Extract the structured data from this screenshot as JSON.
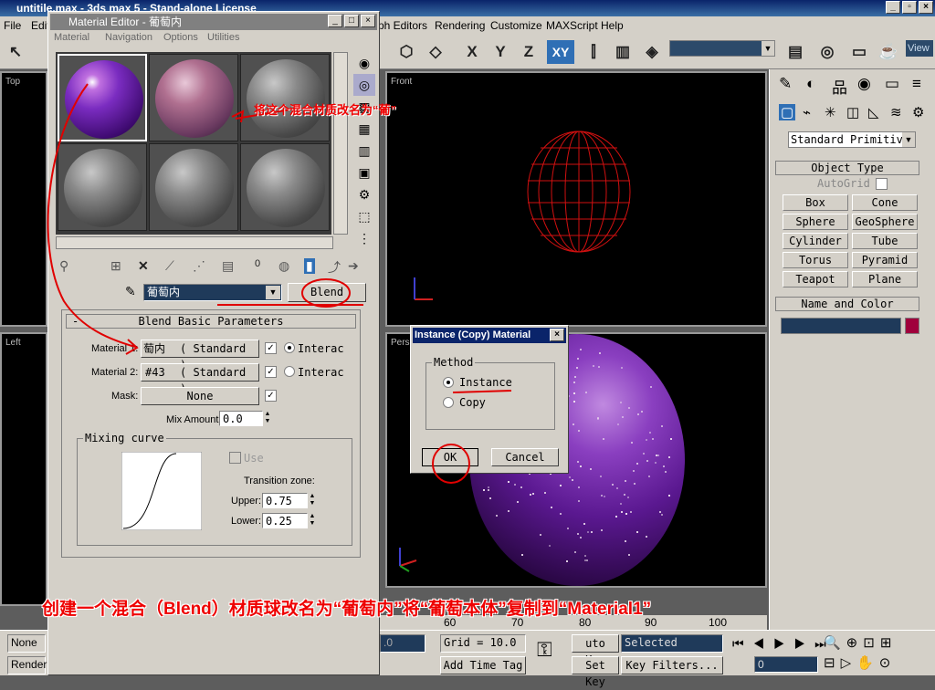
{
  "app": {
    "title": "untitile.max - 3ds max 5 - Stand-alone License"
  },
  "menu": [
    "File",
    "Edit",
    "ph Editors",
    "Rendering",
    "Customize",
    "MAXScript",
    "Help"
  ],
  "toolbar": {
    "axis_x": "X",
    "axis_y": "Y",
    "axis_z": "Z",
    "axis_xy": "XY",
    "view_label": "View"
  },
  "viewports": {
    "top": "Top",
    "left": "Left",
    "front": "Front",
    "perspective": "Pers"
  },
  "command_panel": {
    "dropdown": "Standard Primitiv",
    "object_type_header": "Object Type",
    "autogrid_label": "AutoGrid",
    "buttons": [
      "Box",
      "Cone",
      "Sphere",
      "GeoSphere",
      "Cylinder",
      "Tube",
      "Torus",
      "Pyramid",
      "Teapot",
      "Plane"
    ],
    "name_color_header": "Name and Color",
    "color": "#a0003c"
  },
  "material_editor": {
    "title": "Material Editor - 葡萄内",
    "menu": [
      "Material",
      "Navigation",
      "Options",
      "Utilities"
    ],
    "name_value": "葡萄内",
    "type_button": "Blend",
    "toolbar_zero": "0",
    "rollout_title": "Blend Basic Parameters",
    "material1_label": "Material 1:",
    "material1_name": "萄内",
    "material1_type": "( Standard )",
    "material2_label": "Material 2:",
    "material2_name": "#43",
    "material2_type": "( Standard )",
    "interactive_label": "Interac",
    "mask_label": "Mask:",
    "mask_value": "None",
    "mix_amount_label": "Mix Amount:",
    "mix_amount_value": "0.0",
    "mixing_curve_label": "Mixing curve",
    "use_label": "Use",
    "transition_zone_label": "Transition zone:",
    "upper_label": "Upper:",
    "upper_value": "0.75",
    "lower_label": "Lower:",
    "lower_value": "0.25"
  },
  "dialog": {
    "title": "Instance (Copy) Material",
    "method_label": "Method",
    "option_instance": "Instance",
    "option_copy": "Copy",
    "ok": "OK",
    "cancel": "Cancel"
  },
  "status": {
    "none": "None",
    "render": "Render",
    "ruler": [
      "60",
      "70",
      "80",
      "90",
      "100"
    ],
    "coord_value": ".0",
    "grid": "Grid = 10.0",
    "add_time_tag": "Add Time Tag",
    "auto_key": "uto Key",
    "set_key": "Set Key",
    "selected": "Selected",
    "key_filters": "Key Filters...",
    "frame": "0"
  },
  "annotations": {
    "rename_note": "将这个混合材质改名为“葡”",
    "caption": "创建一个混合（Blend）材质球改名为“葡萄内”将“葡萄本体”复制到“Material1”"
  }
}
